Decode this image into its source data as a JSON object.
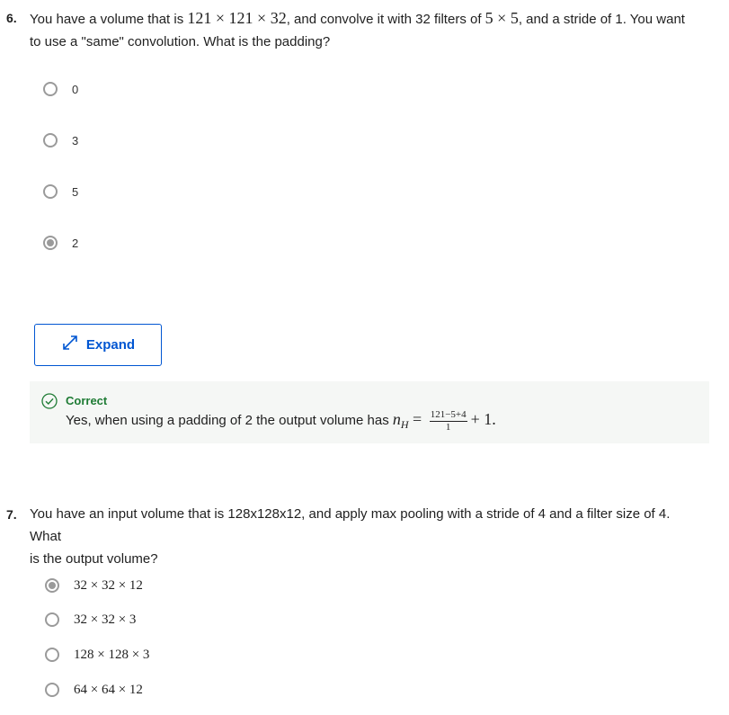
{
  "questions": [
    {
      "number": "6.",
      "text_line1_pre": "You have a volume that is ",
      "text_line1_math1": "121 × 121 × 32",
      "text_line1_mid": ", and convolve it with 32 filters of ",
      "text_line1_math2": "5 × 5",
      "text_line1_post": ", and a stride of 1. You want",
      "text_line2": "to use a \"same\" convolution. What is the padding?",
      "options": [
        {
          "label": "0",
          "selected": false
        },
        {
          "label": "3",
          "selected": false
        },
        {
          "label": "5",
          "selected": false
        },
        {
          "label": "2",
          "selected": true
        }
      ],
      "expand_label": "Expand",
      "feedback": {
        "title": "Correct",
        "text_pre": "Yes, when using a padding of 2 the output volume has ",
        "text_math_lhs": "n",
        "text_math_sub": "H",
        "text_math_eq": " = ",
        "frac_num": "121−5+4",
        "frac_den": "1",
        "text_math_post": "+ 1."
      }
    },
    {
      "number": "7.",
      "text_line1": "You have an input volume that is 128x128x12, and apply max pooling with a stride of 4 and a filter size of 4. What",
      "text_line2": "is the output volume?",
      "options": [
        {
          "label": "32 × 32 × 12",
          "selected": true
        },
        {
          "label": "32 × 32 × 3",
          "selected": false
        },
        {
          "label": "128 × 128 × 3",
          "selected": false
        },
        {
          "label": "64 × 64 × 12",
          "selected": false
        }
      ]
    }
  ],
  "icons": {
    "expand": "expand-arrows-icon",
    "correct": "check-circle-icon"
  },
  "colors": {
    "accent": "#0056d2",
    "correct": "#1e7b34",
    "radio": "#9a9a9a",
    "feedback_bg": "#f5f7f5"
  }
}
